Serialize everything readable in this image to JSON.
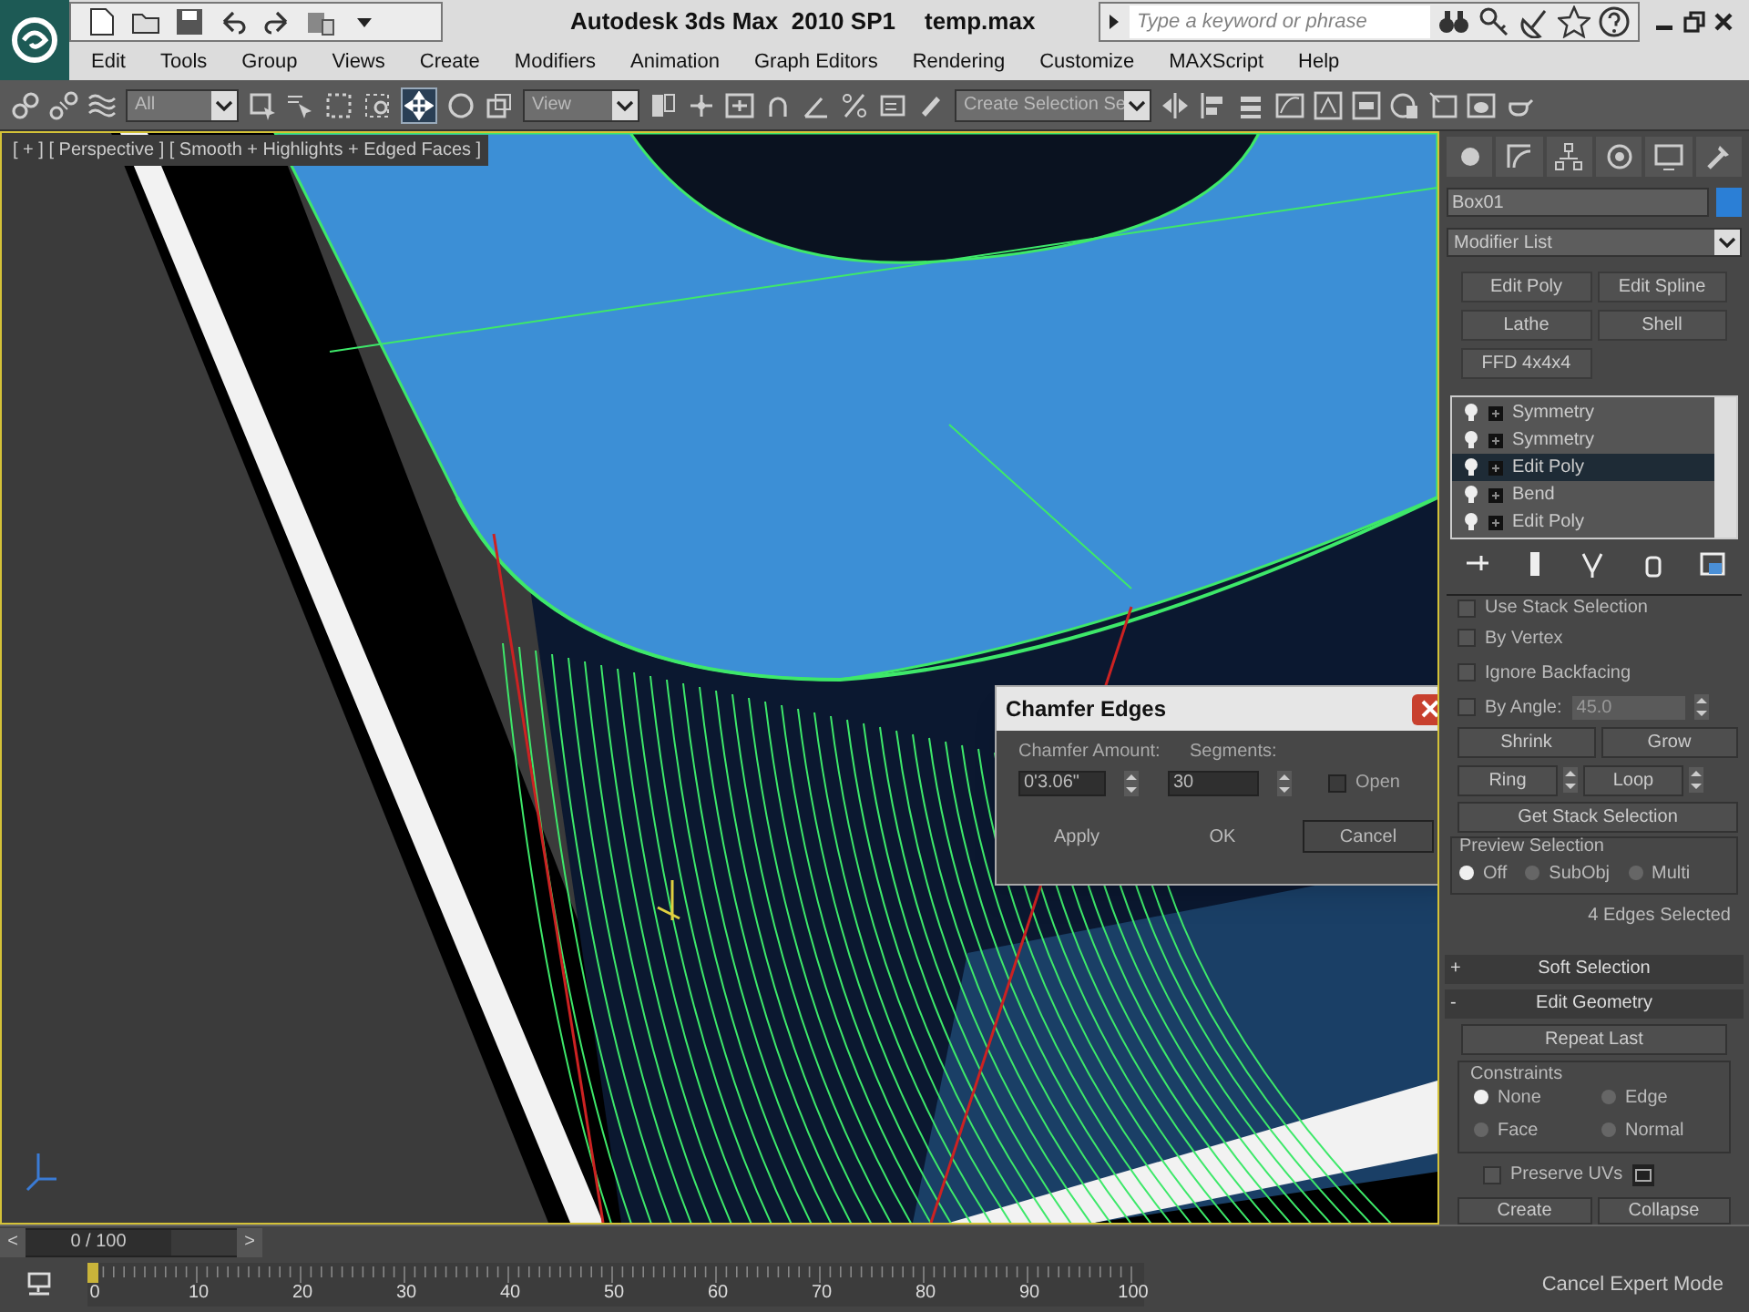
{
  "title_bar": {
    "app_title": "Autodesk 3ds Max  2010 SP1",
    "file_name": "temp.max",
    "search": {
      "placeholder": "Type a keyword or phrase"
    }
  },
  "menu": [
    "Edit",
    "Tools",
    "Group",
    "Views",
    "Create",
    "Modifiers",
    "Animation",
    "Graph Editors",
    "Rendering",
    "Customize",
    "MAXScript",
    "Help"
  ],
  "toolbar": {
    "selection_filter": "All",
    "reference_coord": "View",
    "named_selection": "Create Selection Se"
  },
  "viewport": {
    "label": "[ + ] [ Perspective ] [ Smooth + Highlights + Edged Faces ]"
  },
  "command_panel": {
    "object_name": "Box01",
    "modifier_list": "Modifier List",
    "modifier_buttons": [
      "Edit Poly",
      "Edit Spline",
      "Lathe",
      "Shell",
      "FFD 4x4x4"
    ],
    "stack": [
      {
        "name": "Symmetry",
        "selected": false
      },
      {
        "name": "Symmetry",
        "selected": false
      },
      {
        "name": "Edit Poly",
        "selected": true
      },
      {
        "name": "Bend",
        "selected": false
      },
      {
        "name": "Edit Poly",
        "selected": false
      }
    ],
    "checkboxes": [
      {
        "label": "Use Stack Selection",
        "checked": false
      },
      {
        "label": "By Vertex",
        "checked": false
      },
      {
        "label": "Ignore Backfacing",
        "checked": false
      },
      {
        "label": "By Angle:",
        "checked": false
      }
    ],
    "angle": "45.0",
    "shrink": "Shrink",
    "grow": "Grow",
    "ring": "Ring",
    "loop": "Loop",
    "get_stack": "Get Stack Selection",
    "preview": {
      "title": "Preview Selection",
      "options": [
        {
          "label": "Off",
          "selected": true
        },
        {
          "label": "SubObj",
          "selected": false
        },
        {
          "label": "Multi",
          "selected": false
        }
      ]
    },
    "selection_status": "4 Edges Selected",
    "rollouts": [
      {
        "sign": "+",
        "title": "Soft Selection"
      },
      {
        "sign": "-",
        "title": "Edit Geometry"
      }
    ],
    "repeat_last": "Repeat Last",
    "constraints": {
      "title": "Constraints",
      "options": [
        {
          "label": "None",
          "selected": true
        },
        {
          "label": "Edge",
          "selected": false
        },
        {
          "label": "Face",
          "selected": false
        },
        {
          "label": "Normal",
          "selected": false
        }
      ]
    },
    "preserve_uvs": {
      "label": "Preserve UVs",
      "checked": false
    },
    "bottom_buttons": [
      "Create",
      "Collapse"
    ]
  },
  "dialog": {
    "title": "Chamfer Edges",
    "amount_label": "Chamfer Amount:",
    "amount": "0'3.06\"",
    "segments_label": "Segments:",
    "segments": "30",
    "open": {
      "label": "Open",
      "checked": false
    },
    "buttons": [
      "Apply",
      "OK",
      "Cancel"
    ]
  },
  "timeline": {
    "level": 0,
    "frame": "0 / 100",
    "prev": "<",
    "next": ">",
    "ticks": [
      "0",
      "10",
      "20",
      "30",
      "40",
      "50",
      "60",
      "70",
      "80",
      "90",
      "100"
    ]
  },
  "status": "Cancel Expert Mode"
}
